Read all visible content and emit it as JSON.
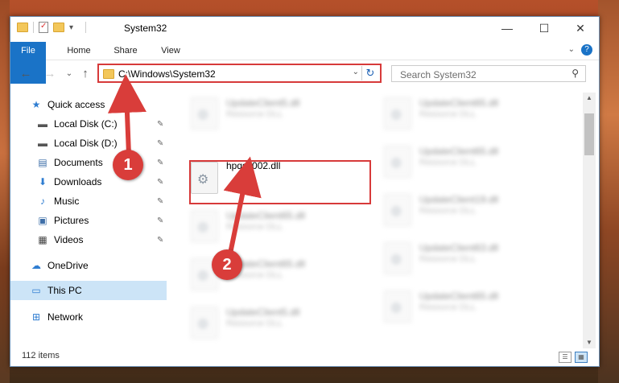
{
  "window": {
    "title": "System32",
    "controls": {
      "minimize": "—",
      "maximize": "☐",
      "close": "✕"
    }
  },
  "ribbon": {
    "tabs": [
      {
        "label": "File"
      },
      {
        "label": "Home"
      },
      {
        "label": "Share"
      },
      {
        "label": "View"
      }
    ],
    "help": "?",
    "expand": "⌄"
  },
  "nav": {
    "back": "←",
    "forward": "→",
    "recent": "⌄",
    "up": "↑",
    "address": "C:\\Windows\\System32",
    "address_dropdown": "⌄",
    "refresh": "↻",
    "search_placeholder": "Search System32"
  },
  "sidebar": {
    "items": [
      {
        "label": "Quick access",
        "icon": "star-icon",
        "glyph": "★",
        "pinned": false
      },
      {
        "label": "Local Disk (C:)",
        "icon": "drive-icon",
        "glyph": "▬",
        "pinned": true
      },
      {
        "label": "Local Disk (D:)",
        "icon": "drive-icon",
        "glyph": "▬",
        "pinned": true
      },
      {
        "label": "Documents",
        "icon": "documents-icon",
        "glyph": "▤",
        "pinned": true
      },
      {
        "label": "Downloads",
        "icon": "download-icon",
        "glyph": "⬇",
        "pinned": true
      },
      {
        "label": "Music",
        "icon": "music-icon",
        "glyph": "♪",
        "pinned": true
      },
      {
        "label": "Pictures",
        "icon": "pictures-icon",
        "glyph": "▣",
        "pinned": true
      },
      {
        "label": "Videos",
        "icon": "videos-icon",
        "glyph": "▦",
        "pinned": true
      },
      {
        "label": "OneDrive",
        "icon": "cloud-icon",
        "glyph": "☁",
        "pinned": false
      },
      {
        "label": "This PC",
        "icon": "computer-icon",
        "glyph": "▭",
        "pinned": false,
        "selected": true
      },
      {
        "label": "Network",
        "icon": "network-icon",
        "glyph": "⊞",
        "pinned": false
      }
    ],
    "pin_glyph": "📌"
  },
  "files": {
    "target": {
      "name": "hpqss002.dll"
    },
    "left_column": [
      {
        "name": "UpdateClient5.dll",
        "type": "Resource DLL"
      },
      {
        "name": "UpdateClient65.dll",
        "type": "Resource DLL"
      },
      {
        "name": "UpdateClient65.dll",
        "type": "Resource DLL"
      },
      {
        "name": "UpdateClient5.dll",
        "type": "Resource DLL"
      }
    ],
    "right_column": [
      {
        "name": "UpdateClient65.dll",
        "type": "Resource DLL"
      },
      {
        "name": "UpdateClient65.dll",
        "type": "Resource DLL"
      },
      {
        "name": "UpdateClient19.dll",
        "type": "Resource DLL"
      },
      {
        "name": "UpdateClient63.dll",
        "type": "Resource DLL"
      },
      {
        "name": "UpdateClient65.dll",
        "type": "Resource DLL"
      }
    ]
  },
  "status": {
    "count": "112 items"
  },
  "annotations": {
    "step1": "1",
    "step2": "2",
    "color": "#d93d3a"
  }
}
